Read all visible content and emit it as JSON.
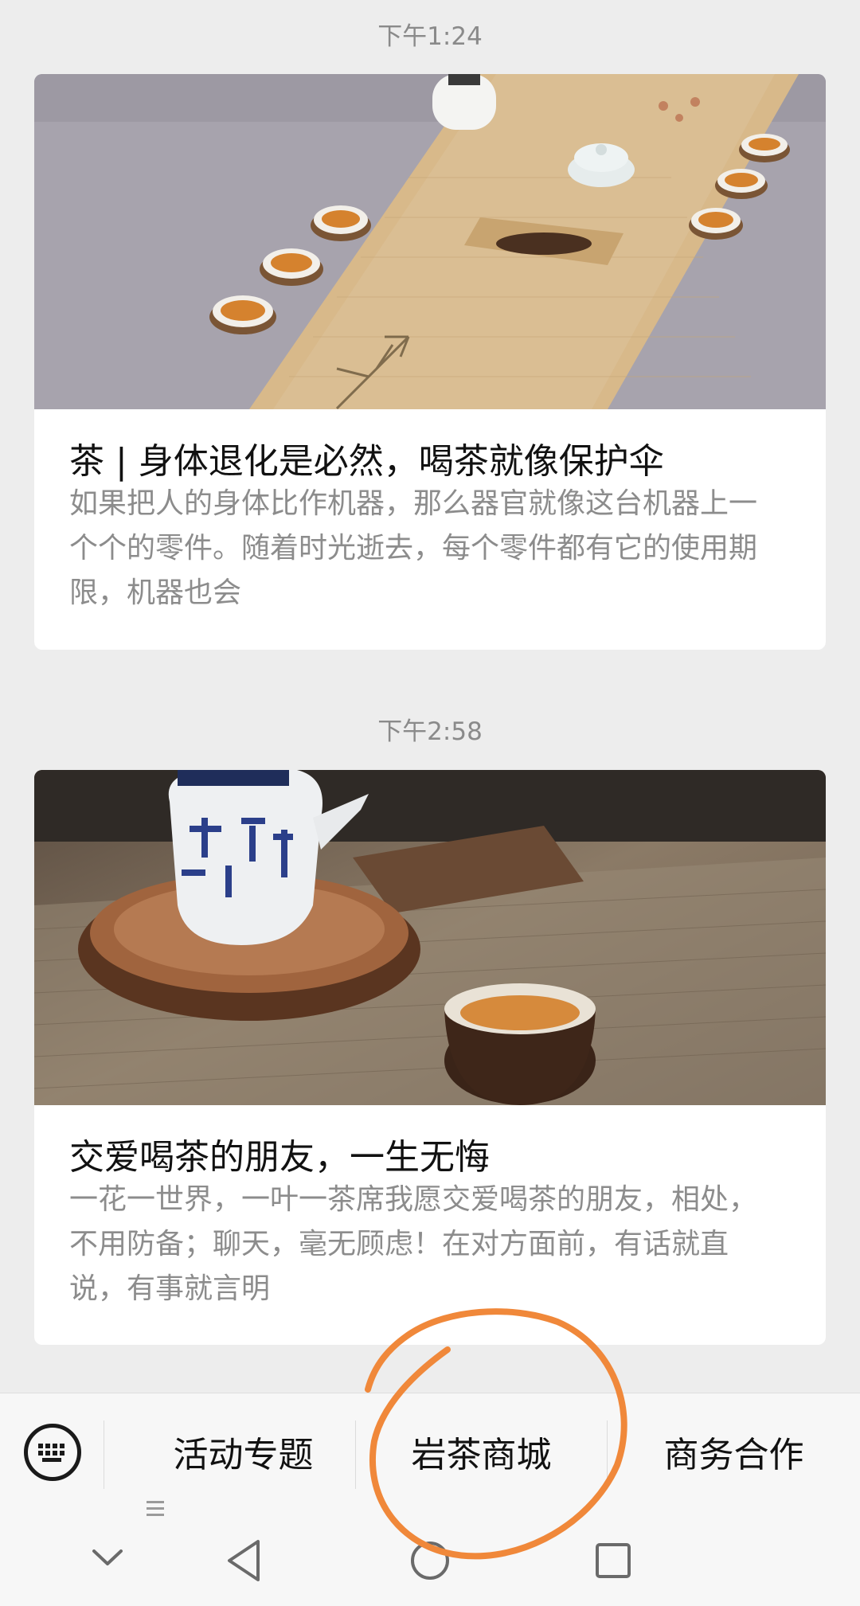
{
  "messages": [
    {
      "time": "下午1:24",
      "title": "茶 | 身体退化是必然，喝茶就像保护伞",
      "description": "如果把人的身体比作机器，那么器官就像这台机器上一个个的零件。随着时光逝去，每个零件都有它的使用期限，机器也会"
    },
    {
      "time": "下午2:58",
      "title": "交爱喝茶的朋友，一生无悔",
      "description": "一花一世界，一叶一茶席我愿交爱喝茶的朋友，相处，不用防备；聊天，毫无顾虑！在对方面前，有话就直说，有事就言明"
    }
  ],
  "menu": {
    "keyboard_icon": "keyboard-icon",
    "items": [
      {
        "label": "活动专题",
        "icon": "menu-lines-icon"
      },
      {
        "label": "岩茶商城"
      },
      {
        "label": "商务合作"
      }
    ]
  },
  "navbar": {
    "icons": [
      "chevron-down-icon",
      "back-triangle-icon",
      "home-circle-icon",
      "recents-square-icon"
    ]
  },
  "colors": {
    "annotation": "#f0883a",
    "background": "#ededed"
  }
}
